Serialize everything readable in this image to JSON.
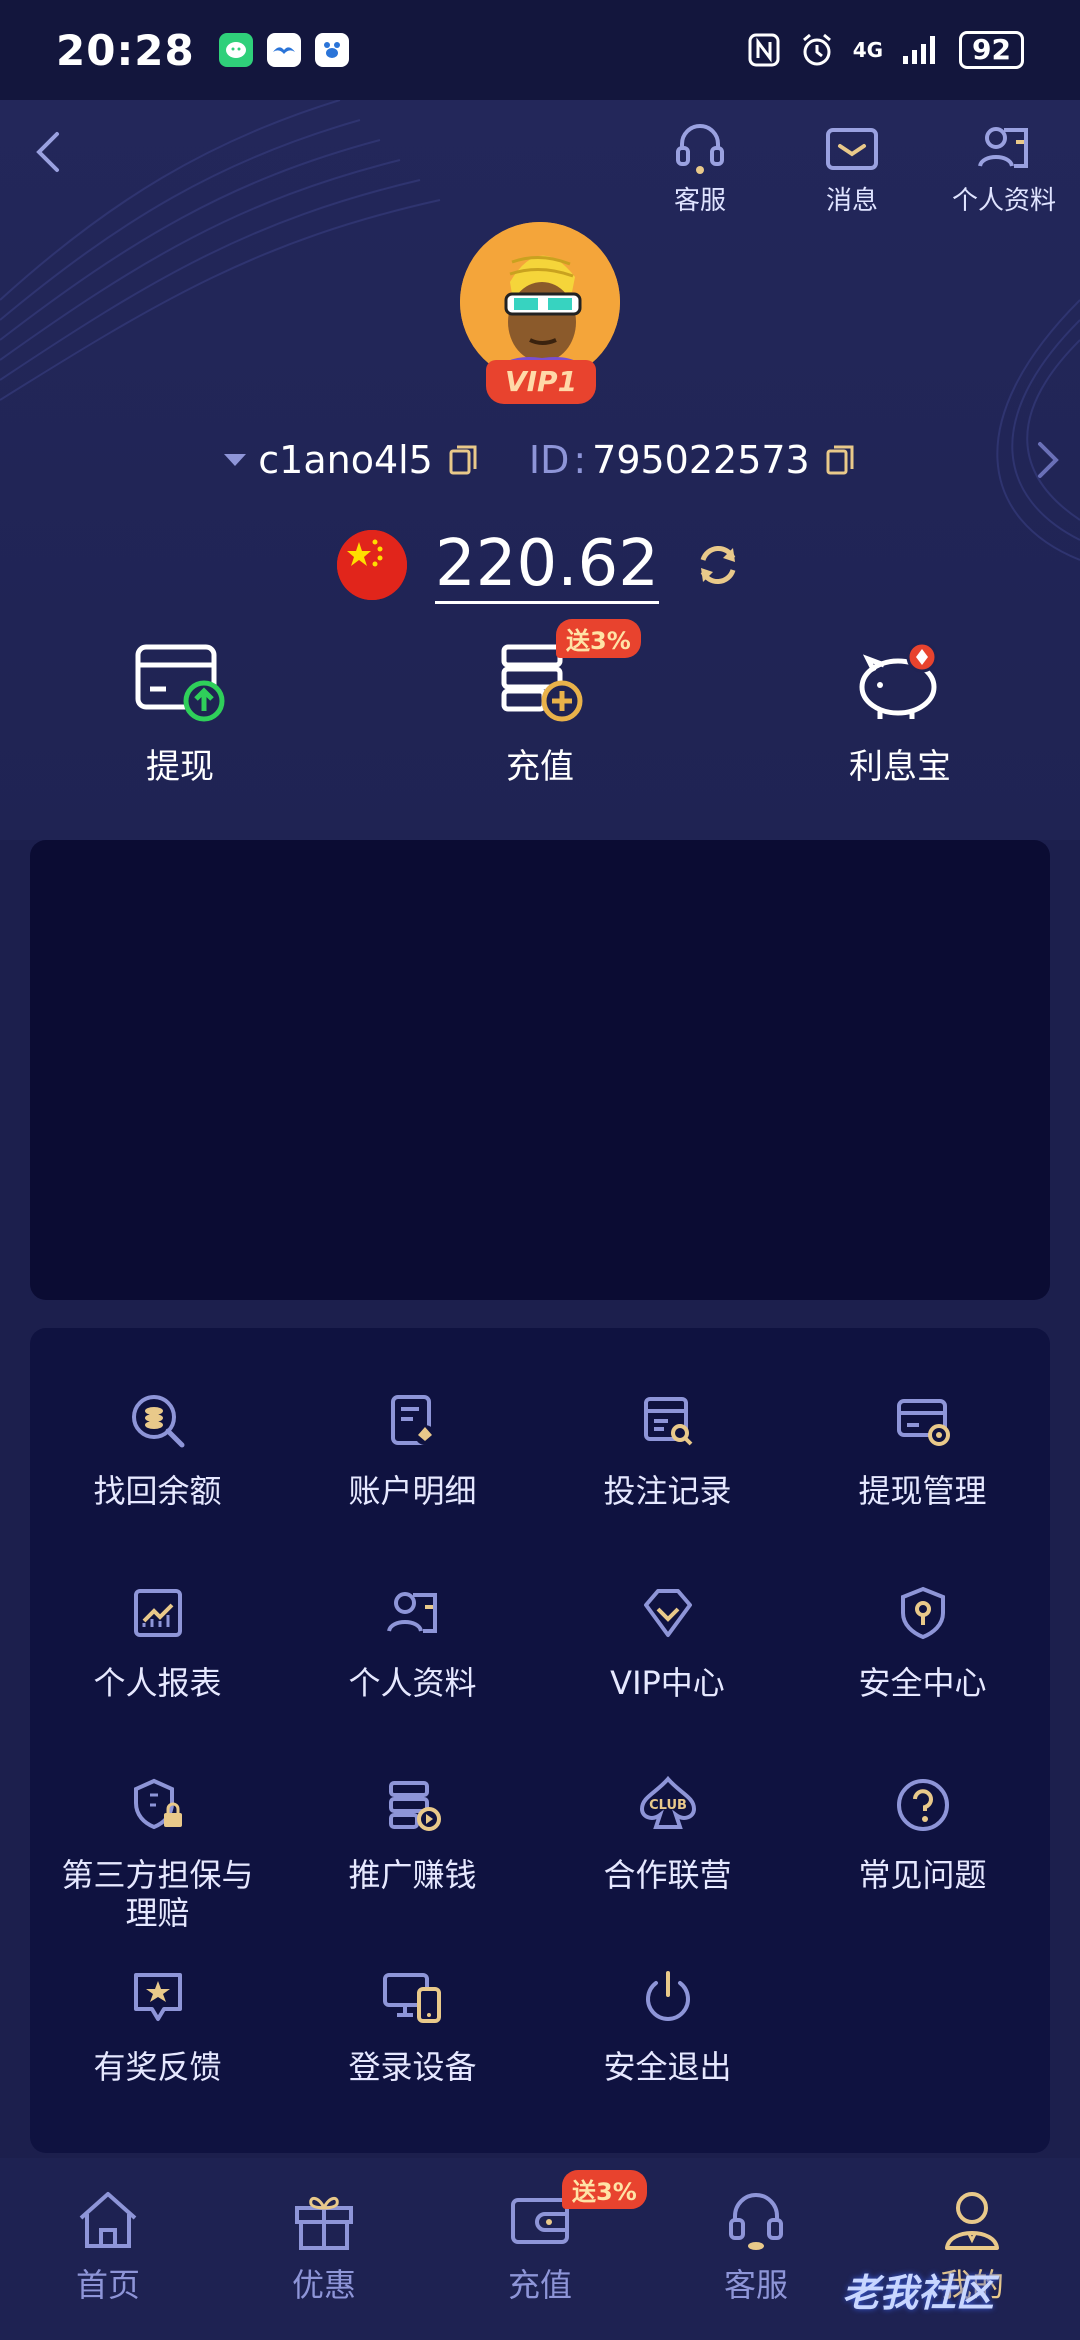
{
  "status_bar": {
    "time": "20:28",
    "network": "4G",
    "battery": "92",
    "apps": [
      "wechat-app-icon",
      "bird-app-icon",
      "paw-app-icon"
    ]
  },
  "header": {
    "actions": [
      {
        "label": "客服",
        "icon": "headset-icon"
      },
      {
        "label": "消息",
        "icon": "mail-icon"
      },
      {
        "label": "个人资料",
        "icon": "profile-card-icon"
      }
    ]
  },
  "user": {
    "vip_badge": "VIP1",
    "username": "c1ano4l5",
    "id_label": "ID",
    "id_sep": ":",
    "id_value": "795022573"
  },
  "balance": {
    "amount": "220.62",
    "currency_flag": "china-flag"
  },
  "quick_actions": [
    {
      "label": "提现",
      "icon": "withdraw-card-icon"
    },
    {
      "label": "充值",
      "icon": "deposit-icon",
      "badge": "送3%"
    },
    {
      "label": "利息宝",
      "icon": "piggy-bank-icon"
    }
  ],
  "menu": [
    {
      "label": "找回余额",
      "icon": "coin-search-icon"
    },
    {
      "label": "账户明细",
      "icon": "document-spade-icon"
    },
    {
      "label": "投注记录",
      "icon": "record-search-icon"
    },
    {
      "label": "提现管理",
      "icon": "card-settings-icon"
    },
    {
      "label": "个人报表",
      "icon": "chart-report-icon"
    },
    {
      "label": "个人资料",
      "icon": "profile-card-icon"
    },
    {
      "label": "VIP中心",
      "icon": "diamond-icon"
    },
    {
      "label": "安全中心",
      "icon": "shield-key-icon"
    },
    {
      "label": "第三方担保与\n理赔",
      "line1": "第三方担保与",
      "line2": "理赔",
      "icon": "shield-lock-icon"
    },
    {
      "label": "推广赚钱",
      "icon": "list-play-icon"
    },
    {
      "label": "合作联营",
      "icon": "club-spade-icon"
    },
    {
      "label": "常见问题",
      "icon": "question-icon"
    },
    {
      "label": "有奖反馈",
      "icon": "star-feedback-icon"
    },
    {
      "label": "登录设备",
      "icon": "devices-icon"
    },
    {
      "label": "安全退出",
      "icon": "power-icon"
    }
  ],
  "tabbar": {
    "tabs": [
      {
        "label": "首页",
        "icon": "home-icon"
      },
      {
        "label": "优惠",
        "icon": "gift-icon"
      },
      {
        "label": "充值",
        "icon": "wallet-icon",
        "badge": "送3%"
      },
      {
        "label": "客服",
        "icon": "headset-icon"
      },
      {
        "label": "我的",
        "icon": "person-icon",
        "active": true
      }
    ]
  },
  "watermark": "老我社区",
  "colors": {
    "accent_gold": "#e9c98a",
    "icon_purple": "#8e95d8",
    "promo_red": "#e8432e",
    "bg": "#1c1f4d"
  }
}
